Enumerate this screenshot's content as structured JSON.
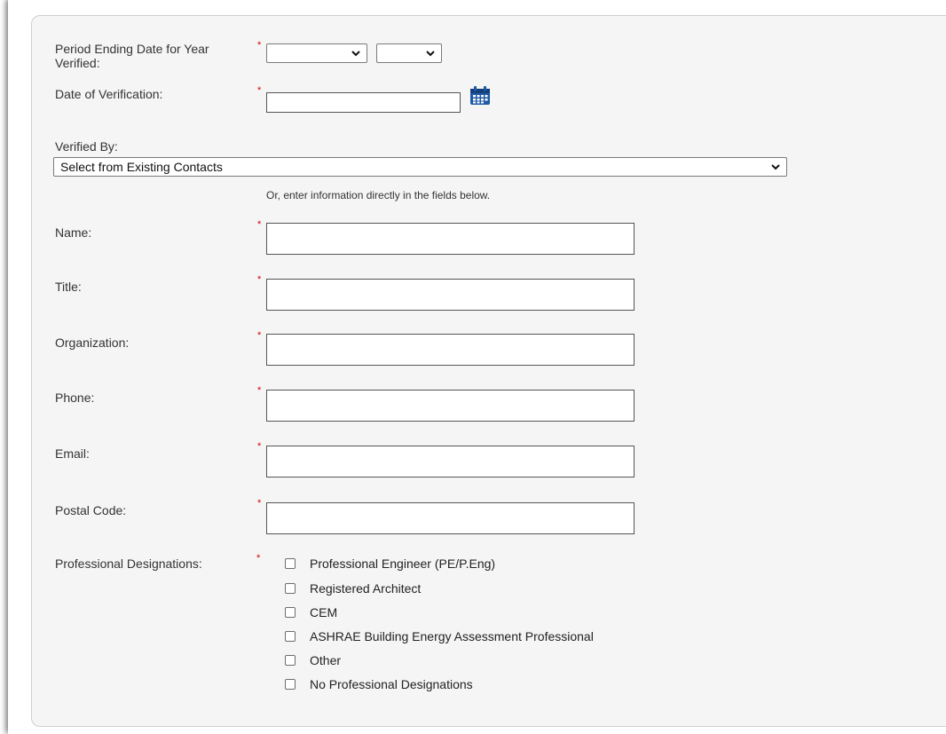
{
  "form": {
    "period": {
      "label": "Period Ending Date for Year Verified:",
      "month_value": "",
      "year_value": ""
    },
    "verification_date": {
      "label": "Date of Verification:",
      "value": ""
    },
    "verified_by": {
      "label": "Verified By:",
      "selected": "Select from Existing Contacts",
      "hint": "Or, enter information directly in the fields below."
    },
    "fields": {
      "name": {
        "label": "Name:",
        "value": ""
      },
      "title": {
        "label": "Title:",
        "value": ""
      },
      "organization": {
        "label": "Organization:",
        "value": ""
      },
      "phone": {
        "label": "Phone:",
        "value": ""
      },
      "email": {
        "label": "Email:",
        "value": ""
      },
      "postal_code": {
        "label": "Postal Code:",
        "value": ""
      }
    },
    "designations": {
      "label": "Professional Designations:",
      "options": [
        {
          "label": "Professional Engineer (PE/P.Eng)",
          "checked": false
        },
        {
          "label": "Registered Architect",
          "checked": false
        },
        {
          "label": "CEM",
          "checked": false
        },
        {
          "label": "ASHRAE Building Energy Assessment Professional",
          "checked": false
        },
        {
          "label": "Other",
          "checked": false
        },
        {
          "label": "No Professional Designations",
          "checked": false
        }
      ]
    },
    "required_marker": "*",
    "icons": {
      "calendar": "calendar-icon",
      "dropdown": "chevron-down-icon"
    },
    "colors": {
      "required": "#d40000",
      "calendar": "#1c5aa6",
      "panel_bg": "#f5f5f5"
    }
  }
}
